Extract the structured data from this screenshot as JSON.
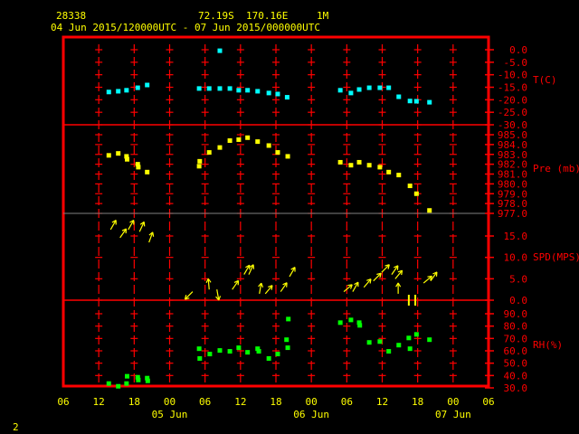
{
  "header": {
    "station_id": "28338",
    "latitude": "72.19S",
    "longitude": "170.16E",
    "level": "1M",
    "time_range": "04 Jun 2015/120000UTC - 07 Jun 2015/000000UTC"
  },
  "footer": {
    "page_number": "2"
  },
  "colors": {
    "frame": "#ff0000",
    "text": "#ffff00",
    "temperature": "#00ffff",
    "pressure": "#ffff00",
    "wind": "#ffff00",
    "rh": "#00ff00"
  },
  "chart_data": {
    "type": "scatter",
    "x_unit": "hours since 04 Jun 06 UTC",
    "xlim": [
      0,
      72
    ],
    "x_tick_labels": [
      "06",
      "12",
      "18",
      "00",
      "06",
      "12",
      "18",
      "00",
      "06",
      "12",
      "18",
      "00",
      "06"
    ],
    "date_labels": [
      {
        "text": "05 Jun",
        "at_hour": 18
      },
      {
        "text": "06 Jun",
        "at_hour": 42
      },
      {
        "text": "07 Jun",
        "at_hour": 66
      }
    ],
    "panels": [
      {
        "name": "temperature",
        "label": "T(C)",
        "ylim": [
          -30,
          0
        ],
        "tick_labels": [
          "0.0",
          "-5.0",
          "-10.0",
          "-15.0",
          "-20.0",
          "-25.0",
          "-30.0"
        ],
        "ticks": [
          0,
          -5,
          -10,
          -15,
          -20,
          -25,
          -30
        ],
        "points": [
          [
            7.7,
            -16.9
          ],
          [
            9.3,
            -16.6
          ],
          [
            10.7,
            -16.2
          ],
          [
            12.6,
            -15.2
          ],
          [
            14.2,
            -14.1
          ],
          [
            23.0,
            -15.5
          ],
          [
            24.7,
            -15.5
          ],
          [
            26.5,
            -0.4
          ],
          [
            26.5,
            -15.5
          ],
          [
            28.2,
            -15.5
          ],
          [
            29.7,
            -16.2
          ],
          [
            31.2,
            -16.2
          ],
          [
            32.9,
            -16.6
          ],
          [
            34.8,
            -17.3
          ],
          [
            36.3,
            -17.7
          ],
          [
            37.9,
            -19.0
          ],
          [
            46.9,
            -16.2
          ],
          [
            48.7,
            -17.3
          ],
          [
            50.1,
            -15.9
          ],
          [
            51.8,
            -15.2
          ],
          [
            53.6,
            -15.2
          ],
          [
            55.1,
            -15.2
          ],
          [
            56.8,
            -18.8
          ],
          [
            58.7,
            -20.5
          ],
          [
            59.8,
            -20.6
          ],
          [
            62.0,
            -21.0
          ]
        ]
      },
      {
        "name": "pressure",
        "label": "Pre (mb)",
        "ylim": [
          977,
          985
        ],
        "tick_labels": [
          "985.0",
          "984.0",
          "983.0",
          "982.0",
          "981.0",
          "980.0",
          "979.0",
          "978.0",
          "977.0"
        ],
        "ticks": [
          985,
          984,
          983,
          982,
          981,
          980,
          979,
          978,
          977
        ],
        "points": [
          [
            7.7,
            982.9
          ],
          [
            9.3,
            983.1
          ],
          [
            10.7,
            982.8
          ],
          [
            10.8,
            982.5
          ],
          [
            12.6,
            982.0
          ],
          [
            12.7,
            981.7
          ],
          [
            14.2,
            981.2
          ],
          [
            23.0,
            981.8
          ],
          [
            23.1,
            982.3
          ],
          [
            24.7,
            983.2
          ],
          [
            26.5,
            983.7
          ],
          [
            28.2,
            984.4
          ],
          [
            29.7,
            984.5
          ],
          [
            31.2,
            984.7
          ],
          [
            32.9,
            984.3
          ],
          [
            34.8,
            983.9
          ],
          [
            36.3,
            983.2
          ],
          [
            38.0,
            982.8
          ],
          [
            46.9,
            982.2
          ],
          [
            48.7,
            981.9
          ],
          [
            50.1,
            982.2
          ],
          [
            51.8,
            981.9
          ],
          [
            53.6,
            981.7
          ],
          [
            55.1,
            981.2
          ],
          [
            56.8,
            980.9
          ],
          [
            58.7,
            979.8
          ],
          [
            59.8,
            979.0
          ],
          [
            62.0,
            977.3
          ]
        ]
      },
      {
        "name": "wind_speed",
        "label": "SPD(MPS)",
        "ylim": [
          0,
          15
        ],
        "tick_labels": [
          "15.0",
          "10.0",
          "5.0",
          "0.0"
        ],
        "ticks": [
          15,
          10,
          5,
          0
        ],
        "winds": [
          [
            8.0,
            16.5,
            210
          ],
          [
            9.6,
            14.6,
            215
          ],
          [
            11.0,
            16.5,
            210
          ],
          [
            12.9,
            16.0,
            205
          ],
          [
            14.5,
            13.5,
            200
          ],
          [
            21.9,
            2.0,
            45
          ],
          [
            24.7,
            2.5,
            175
          ],
          [
            26.0,
            2.5,
            350
          ],
          [
            28.6,
            2.5,
            215
          ],
          [
            30.6,
            6.0,
            210
          ],
          [
            31.4,
            6.0,
            205
          ],
          [
            33.2,
            1.5,
            190
          ],
          [
            34.2,
            1.5,
            220
          ],
          [
            36.8,
            2.0,
            215
          ],
          [
            38.3,
            5.5,
            210
          ],
          [
            47.5,
            2.0,
            230
          ],
          [
            49.0,
            2.0,
            210
          ],
          [
            50.9,
            3.0,
            220
          ],
          [
            52.5,
            4.5,
            225
          ],
          [
            53.9,
            6.5,
            225
          ],
          [
            55.6,
            6.0,
            215
          ],
          [
            56.2,
            5.0,
            220
          ],
          [
            56.7,
            1.5,
            180
          ],
          [
            58.5,
            0.0,
            null
          ],
          [
            59.6,
            0.0,
            null
          ],
          [
            61.0,
            4.0,
            230
          ],
          [
            62.2,
            4.5,
            215
          ]
        ]
      },
      {
        "name": "relative_humidity",
        "label": "RH(%)",
        "ylim": [
          30,
          90
        ],
        "tick_labels": [
          "90.0",
          "80.0",
          "70.0",
          "60.0",
          "50.0",
          "40.0",
          "30.0"
        ],
        "ticks": [
          90,
          80,
          70,
          60,
          50,
          40,
          30
        ],
        "points": [
          [
            7.7,
            33.5
          ],
          [
            9.3,
            31.3
          ],
          [
            10.7,
            33.5
          ],
          [
            10.8,
            39.4
          ],
          [
            12.6,
            38.6
          ],
          [
            12.7,
            36.4
          ],
          [
            14.2,
            37.9
          ],
          [
            14.3,
            35.7
          ],
          [
            23.0,
            61.7
          ],
          [
            23.1,
            53.8
          ],
          [
            24.8,
            57.4
          ],
          [
            26.5,
            60.3
          ],
          [
            28.2,
            59.6
          ],
          [
            29.7,
            62.5
          ],
          [
            31.2,
            58.8
          ],
          [
            32.9,
            61.7
          ],
          [
            33.1,
            59.6
          ],
          [
            34.8,
            53.8
          ],
          [
            36.3,
            57.4
          ],
          [
            37.8,
            69.0
          ],
          [
            38.0,
            62.5
          ],
          [
            38.1,
            85.7
          ],
          [
            46.9,
            82.8
          ],
          [
            48.7,
            85.0
          ],
          [
            50.1,
            82.8
          ],
          [
            50.2,
            80.6
          ],
          [
            51.8,
            66.8
          ],
          [
            53.6,
            67.5
          ],
          [
            55.1,
            59.6
          ],
          [
            56.8,
            64.6
          ],
          [
            58.7,
            61.7
          ],
          [
            58.5,
            70.4
          ],
          [
            59.8,
            73.3
          ],
          [
            62.0,
            69.0
          ]
        ]
      }
    ]
  }
}
